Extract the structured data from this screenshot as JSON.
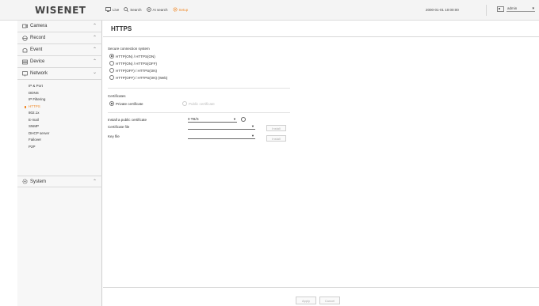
{
  "header": {
    "logo": "WISENET",
    "nav": [
      {
        "label": "Live",
        "icon": "monitor-icon",
        "active": false
      },
      {
        "label": "Search",
        "icon": "search-icon",
        "active": false
      },
      {
        "label": "AI search",
        "icon": "ai-search-icon",
        "active": false
      },
      {
        "label": "Setup",
        "icon": "gear-icon",
        "active": true
      }
    ],
    "datetime": "2000-01-01 10:00:00",
    "user": "admin"
  },
  "sidebar": {
    "items": [
      {
        "label": "Camera",
        "icon": "camera-icon"
      },
      {
        "label": "Record",
        "icon": "record-icon"
      },
      {
        "label": "Event",
        "icon": "event-icon"
      },
      {
        "label": "Device",
        "icon": "device-icon"
      },
      {
        "label": "Network",
        "icon": "network-icon"
      },
      {
        "label": "System",
        "icon": "system-icon"
      }
    ],
    "network_sub": [
      "IP & Port",
      "DDNS",
      "IP Filtering",
      "HTTPS",
      "802.1x",
      "E-mail",
      "SNMP",
      "DHCP server",
      "Failover",
      "P2P"
    ],
    "active_sub": "HTTPS"
  },
  "content": {
    "title": "HTTPS",
    "secure_label": "Secure connection system",
    "secure_options": [
      "HTTP(ON) / HTTPS(ON)",
      "HTTP(ON) / HTTPS(OFF)",
      "HTTP(OFF) / HTTPS(ON)",
      "HTTP(OFF) / HTTPS(ON) (Web)"
    ],
    "cert_label": "Certificates",
    "cert_options": [
      "Private certificate",
      "Public certificate"
    ],
    "install_label": "Install a public certificate",
    "install_value": "0 TB/S",
    "cert_file_label": "Certificate file",
    "key_file_label": "Key file",
    "install_btn": "Install"
  },
  "footer": {
    "apply": "Apply",
    "cancel": "Cancel"
  }
}
